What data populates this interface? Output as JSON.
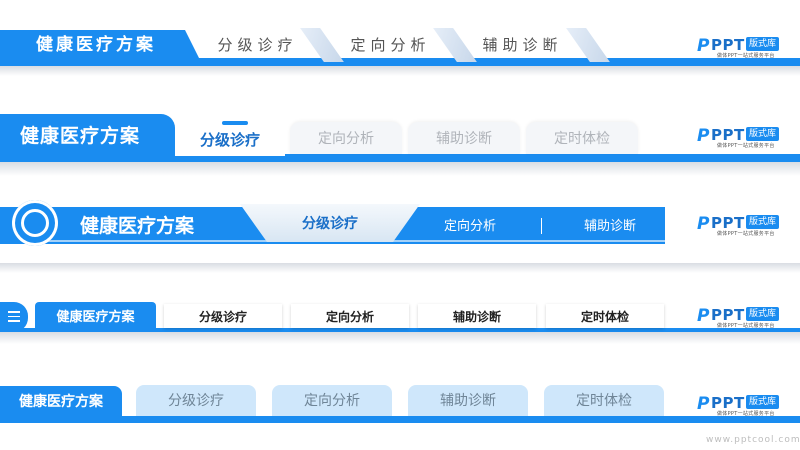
{
  "colors": {
    "accent": "#1a8cf0",
    "dark_accent": "#1a6fc8",
    "light_tab": "#cfe7fb"
  },
  "logo": {
    "mark": "P",
    "name": "PPT",
    "badge": "版式库",
    "tagline": "做体PPT一站式服务平台"
  },
  "banner1": {
    "title": "健康医疗方案",
    "tabs": [
      "分级诊疗",
      "定向分析",
      "辅助诊断"
    ]
  },
  "banner2": {
    "title": "健康医疗方案",
    "active_tab": "分级诊疗",
    "tabs": [
      "定向分析",
      "辅助诊断",
      "定时体检"
    ]
  },
  "banner3": {
    "title": "健康医疗方案",
    "active_tab": "分级诊疗",
    "tabs": [
      "定向分析",
      "辅助诊断"
    ]
  },
  "banner4": {
    "title": "健康医疗方案",
    "menu_icon": "hamburger-icon",
    "tabs": [
      "分级诊疗",
      "定向分析",
      "辅助诊断",
      "定时体检"
    ]
  },
  "banner5": {
    "title": "健康医疗方案",
    "tabs": [
      "分级诊疗",
      "定向分析",
      "辅助诊断",
      "定时体检"
    ]
  },
  "watermark": "www.pptcool.com"
}
